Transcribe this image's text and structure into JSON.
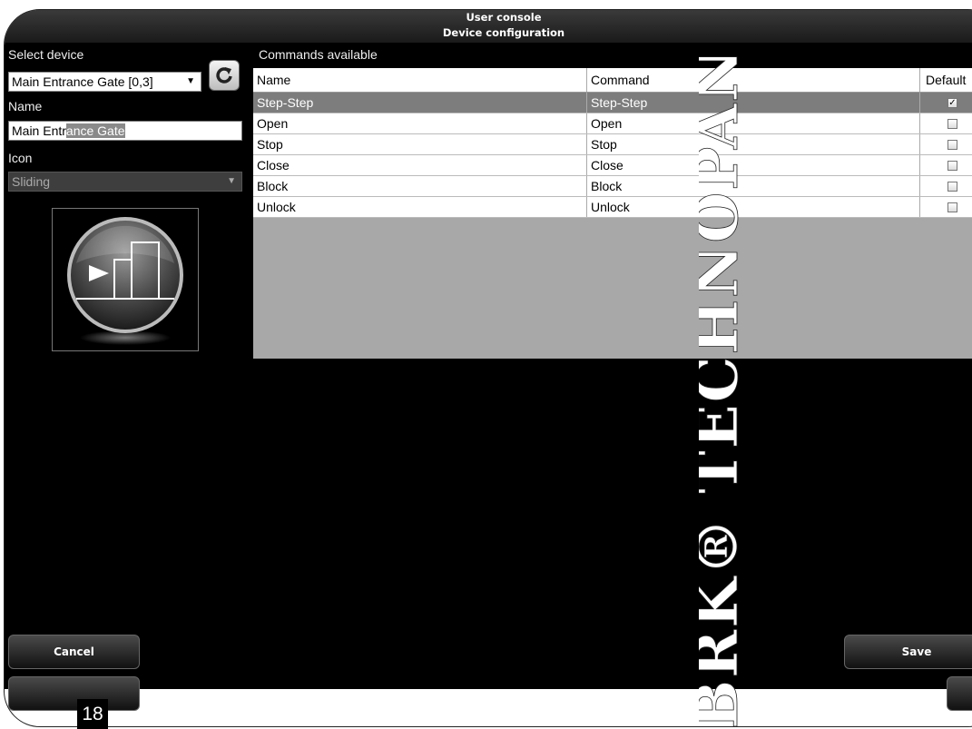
{
  "titlebar": {
    "line1": "User console",
    "line2": "Device configuration"
  },
  "left": {
    "select_device_label": "Select device",
    "select_device_value": "Main Entrance Gate [0,3]",
    "name_label": "Name",
    "name_value_plain": "Main Entr",
    "name_value_selected": "ance Gate",
    "icon_label": "Icon",
    "icon_value": "Sliding",
    "preview_icon": "sliding-gate-icon"
  },
  "commands": {
    "label": "Commands available",
    "headers": {
      "name": "Name",
      "command": "Command",
      "default": "Default"
    },
    "rows": [
      {
        "name": "Step-Step",
        "command": "Step-Step",
        "default": true
      },
      {
        "name": "Open",
        "command": "Open",
        "default": false
      },
      {
        "name": "Stop",
        "command": "Stop",
        "default": false
      },
      {
        "name": "Close",
        "command": "Close",
        "default": false
      },
      {
        "name": "Block",
        "command": "Block",
        "default": false
      },
      {
        "name": "Unlock",
        "command": "Unlock",
        "default": false
      }
    ]
  },
  "buttons": {
    "cancel": "Cancel",
    "save": "Save"
  },
  "watermark": "BRK® TECHNOPAN",
  "page_number": "18",
  "colors": {
    "highlight_row": "#7d7d7d",
    "empty_table": "#a8a8a8",
    "screen_bg": "#000000"
  }
}
